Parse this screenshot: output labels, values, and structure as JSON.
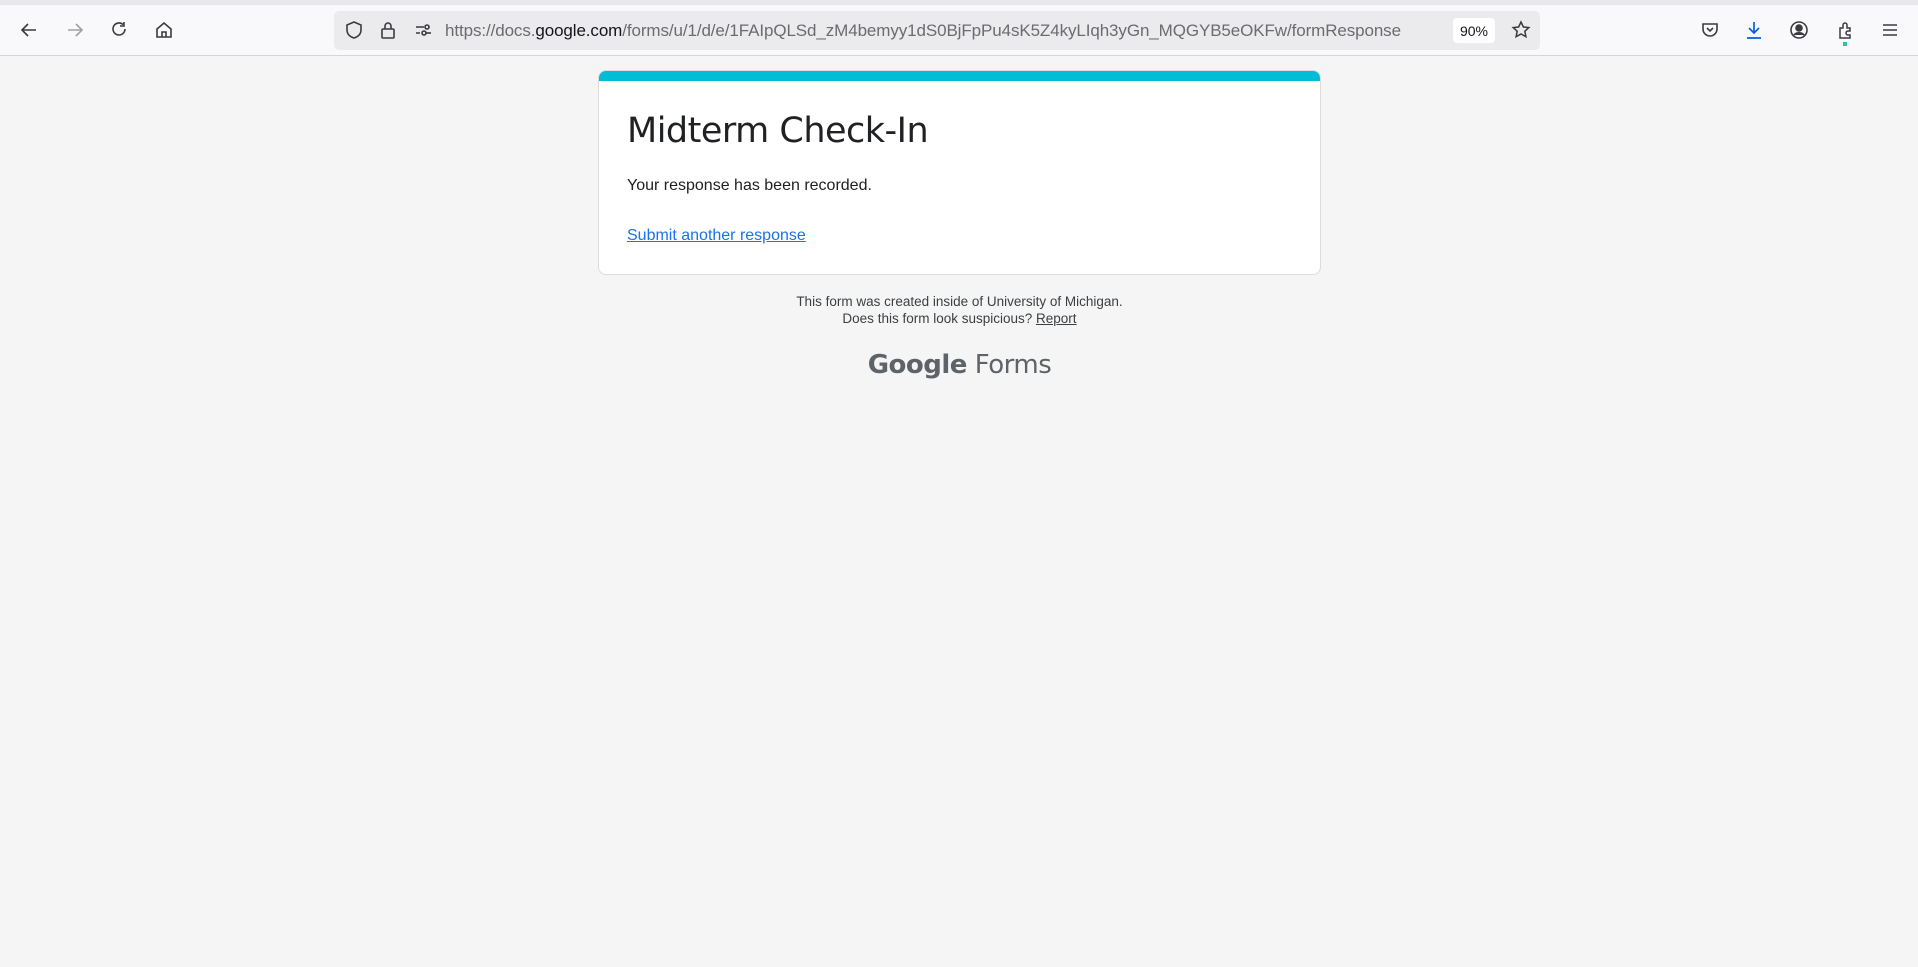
{
  "browser": {
    "url_prefix": "https://docs.",
    "url_domain": "google.com",
    "url_path": "/forms/u/1/d/e/1FAIpQLSd_zM4bemyy1dS0BjFpPu4sK5Z4kyLIqh3yGn_MQGYB5eOKFw/formResponse",
    "zoom_level": "90%",
    "icons": [
      "back-icon",
      "forward-icon",
      "reload-icon",
      "home-icon",
      "shield-icon",
      "lock-icon",
      "permissions-icon",
      "star-icon",
      "pocket-icon",
      "download-icon",
      "account-icon",
      "extensions-icon",
      "menu-icon"
    ]
  },
  "form": {
    "accent_color": "#00bcd4",
    "title": "Midterm Check-In",
    "confirmation": "Your response has been recorded.",
    "submit_another": "Submit another response"
  },
  "footer": {
    "created_inside": "This form was created inside of University of Michigan.",
    "suspicious": "Does this form look suspicious?",
    "report": "Report",
    "logo_google": "Google",
    "logo_forms": "Forms"
  }
}
